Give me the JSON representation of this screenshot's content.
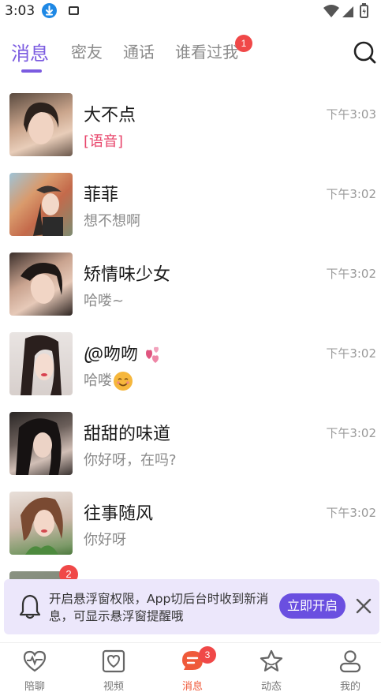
{
  "status_bar": {
    "time": "3:03"
  },
  "tabs": {
    "items": [
      {
        "label": "消息"
      },
      {
        "label": "密友"
      },
      {
        "label": "通话"
      },
      {
        "label": "谁看过我",
        "badge": "1"
      }
    ],
    "search_icon": "search-icon"
  },
  "conversations": [
    {
      "name": "大不点",
      "preview": "[语音]",
      "time": "下午3:03"
    },
    {
      "name": "菲菲",
      "preview": "想不想啊",
      "time": "下午3:02"
    },
    {
      "name": "矫情味少女",
      "preview": "哈喽~",
      "time": "下午3:02"
    },
    {
      "name": "@ꦿ吻吻",
      "preview": "哈喽",
      "time": "下午3:02"
    },
    {
      "name": "甜甜的味道",
      "preview": "你好呀，在吗?",
      "time": "下午3:02"
    },
    {
      "name": "往事随风",
      "preview": "你好呀",
      "time": "下午3:02"
    }
  ],
  "partial_row": {
    "badge": "2"
  },
  "notice": {
    "text": "开启悬浮窗权限，App切后台时收到新消息，可显示悬浮窗提醒哦",
    "button": "立即开启"
  },
  "bottom_nav": [
    {
      "label": "陪聊",
      "icon": "heartbeat-icon"
    },
    {
      "label": "视频",
      "icon": "video-heart-icon"
    },
    {
      "label": "消息",
      "icon": "message-icon",
      "badge": "3",
      "active": true
    },
    {
      "label": "动态",
      "icon": "star-icon"
    },
    {
      "label": "我的",
      "icon": "profile-icon"
    }
  ],
  "colors": {
    "accent": "#7b5be0",
    "badge": "#f04848",
    "nav_active": "#ef5a3a",
    "voice_text": "#e8456b",
    "notice_bg": "#ece7fb"
  }
}
